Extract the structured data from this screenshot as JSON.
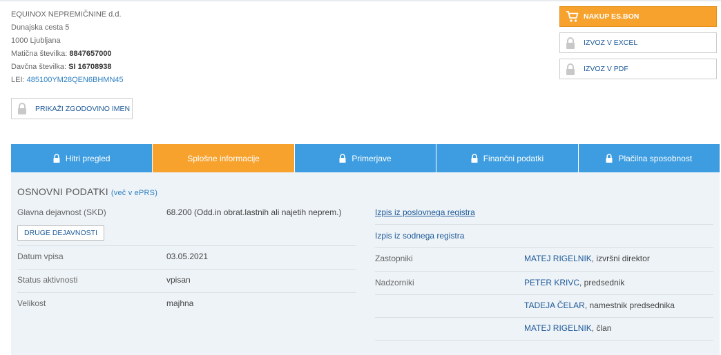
{
  "company": {
    "name": "EQUINOX NEPREMIČNINE d.d.",
    "street": "Dunajska cesta 5",
    "city": "1000 Ljubljana",
    "reg_label": "Matična številka: ",
    "reg_value": "8847657000",
    "tax_label": "Davčna številka: ",
    "tax_value": "SI 16708938",
    "lei_label": "LEI: ",
    "lei_value": "485100YM28QEN6BHMN45"
  },
  "buttons": {
    "history": "PRIKAŽI ZGODOVINO IMEN",
    "buy": "NAKUP eS.BON",
    "excel": "IZVOZ V EXCEL",
    "pdf": "IZVOZ V PDF",
    "other_activities": "DRUGE DEJAVNOSTI"
  },
  "tabs": [
    {
      "label": "Hitri pregled",
      "locked": true
    },
    {
      "label": "Splošne informacije",
      "locked": false,
      "active": true
    },
    {
      "label": "Primerjave",
      "locked": true
    },
    {
      "label": "Finančni podatki",
      "locked": true
    },
    {
      "label": "Plačilna sposobnost",
      "locked": true
    }
  ],
  "section": {
    "title": "OSNOVNI PODATKI",
    "more": "(več v ePRS)"
  },
  "basic": {
    "activity_label": "Glavna dejavnost (SKD)",
    "activity_value": "68.200 (Odd.in obrat.lastnih ali najetih neprem.)",
    "date_label": "Datum vpisa",
    "date_value": "03.05.2021",
    "status_label": "Status aktivnosti",
    "status_value": "vpisan",
    "size_label": "Velikost",
    "size_value": "majhna"
  },
  "registers": {
    "business": "Izpis iz poslovnega registra",
    "court": "Izpis iz sodnega registra"
  },
  "representatives": {
    "label": "Zastopniki",
    "people": [
      {
        "name": "MATEJ RIGELNIK",
        "role": ", izvršni direktor"
      }
    ]
  },
  "supervisors": {
    "label": "Nadzorniki",
    "people": [
      {
        "name": "PETER KRIVC",
        "role": ", predsednik"
      },
      {
        "name": "TADEJA ČELAR",
        "role": ", namestnik predsednika"
      },
      {
        "name": "MATEJ RIGELNIK",
        "role": ", član"
      }
    ]
  },
  "colors": {
    "accent_orange": "#f7a22d",
    "tab_blue": "#3d9de0",
    "link_blue": "#1e5a99",
    "panel_bg": "#eef3f7"
  }
}
